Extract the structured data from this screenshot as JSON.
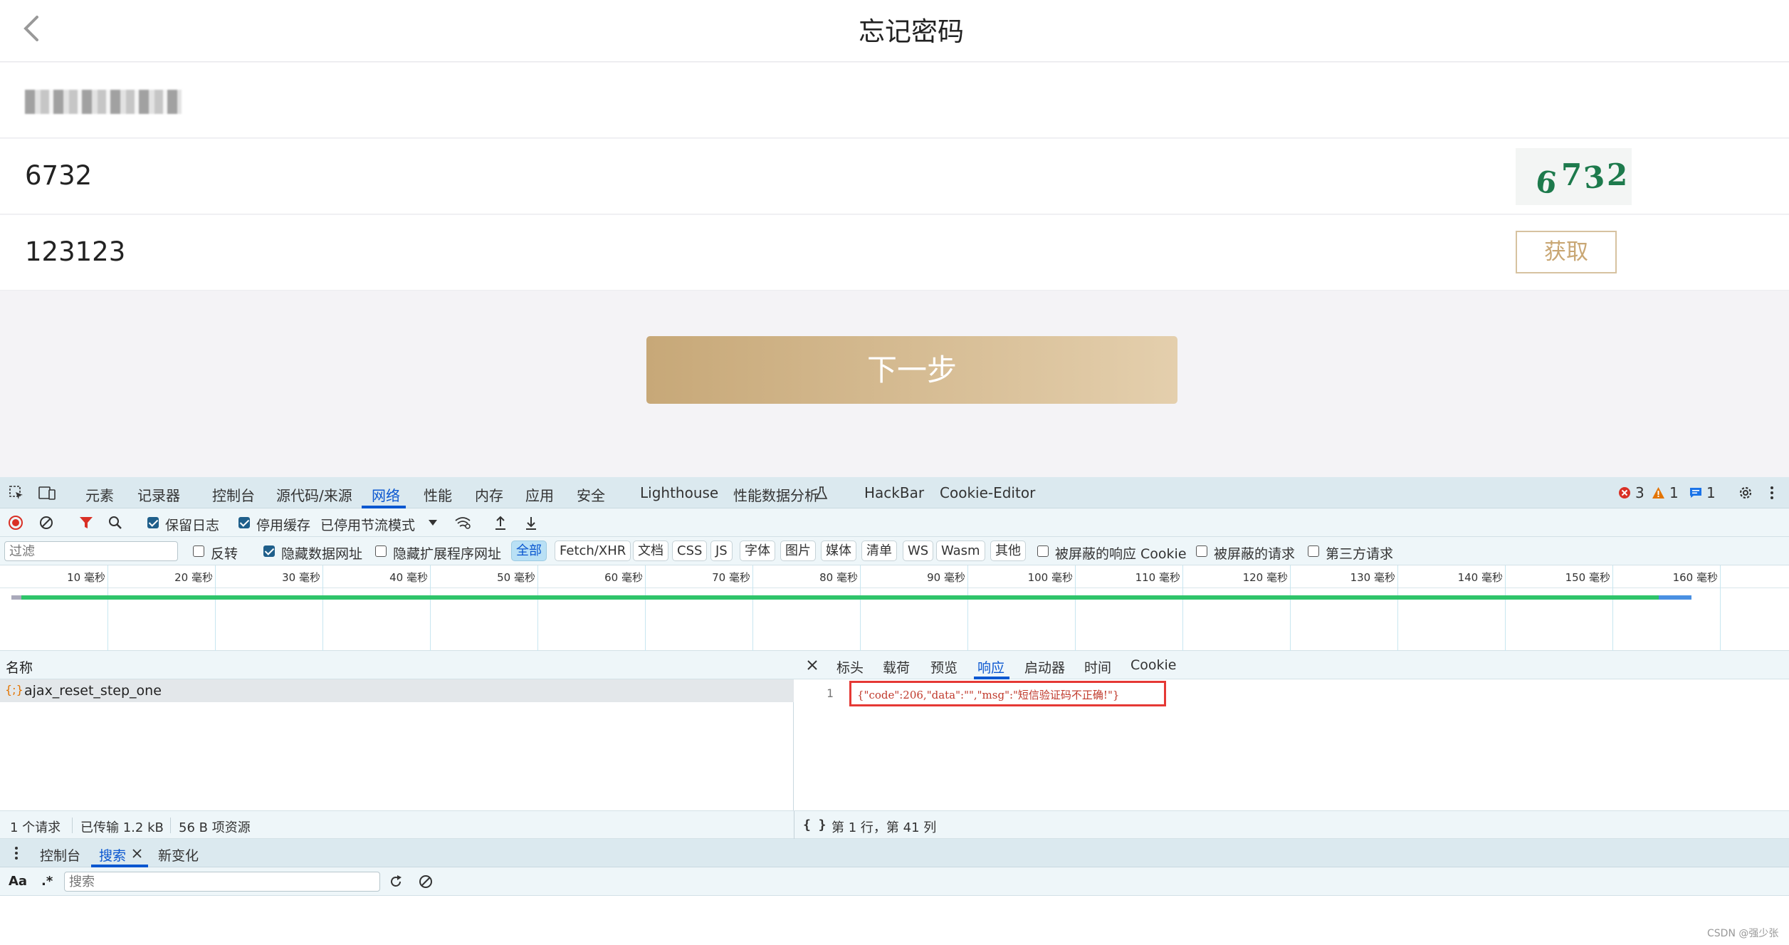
{
  "app": {
    "title": "忘记密码",
    "phone_value": "1●● ●●●●●●●",
    "captcha_value": "6732",
    "captcha_image_text": "6 7 3 2",
    "sms_code_value": "123123",
    "get_code_label": "获取",
    "next_label": "下一步"
  },
  "devtools": {
    "main_tabs": [
      "元素",
      "记录器",
      "控制台",
      "源代码/来源",
      "网络",
      "性能",
      "内存",
      "应用",
      "安全",
      "Lighthouse",
      "性能数据分析",
      "HackBar",
      "Cookie-Editor"
    ],
    "active_tab": "网络",
    "badges": {
      "errors": "3",
      "warnings": "1",
      "messages": "1"
    },
    "toolbar": {
      "preserve_log": "保留日志",
      "disable_cache": "停用缓存",
      "throttle": "已停用节流模式"
    },
    "filter": {
      "placeholder": "过滤",
      "invert": "反转",
      "hide_data_urls": "隐藏数据网址",
      "hide_extension_urls": "隐藏扩展程序网址",
      "types": [
        "全部",
        "Fetch/XHR",
        "文档",
        "CSS",
        "JS",
        "字体",
        "图片",
        "媒体",
        "清单",
        "WS",
        "Wasm",
        "其他"
      ],
      "blocked_cookies": "被屏蔽的响应 Cookie",
      "blocked_requests": "被屏蔽的请求",
      "third_party": "第三方请求"
    },
    "timeline_ticks": [
      "10 毫秒",
      "20 毫秒",
      "30 毫秒",
      "40 毫秒",
      "50 毫秒",
      "60 毫秒",
      "70 毫秒",
      "80 毫秒",
      "90 毫秒",
      "100 毫秒",
      "110 毫秒",
      "120 毫秒",
      "130 毫秒",
      "140 毫秒",
      "150 毫秒",
      "160 毫秒"
    ],
    "requests": {
      "header": "名称",
      "rows": [
        {
          "icon": "{;}",
          "name": "ajax_reset_step_one"
        }
      ]
    },
    "detail": {
      "tabs": [
        "标头",
        "载荷",
        "预览",
        "响应",
        "启动器",
        "时间",
        "Cookie"
      ],
      "active": "响应",
      "line_number": "1",
      "response": "{\"code\":206,\"data\":\"\",\"msg\":\"短信验证码不正确!\"}",
      "cursor": "第 1 行，第 41 列"
    },
    "status": {
      "requests": "1 个请求",
      "transferred": "已传输 1.2 kB",
      "resources": "56 B 项资源"
    },
    "drawer": {
      "tabs": [
        "控制台",
        "搜索",
        "新变化"
      ],
      "active": "搜索",
      "case_label": "Aa",
      "regex_label": ".*",
      "search_placeholder": "搜索"
    }
  },
  "watermark": "CSDN @强少张"
}
